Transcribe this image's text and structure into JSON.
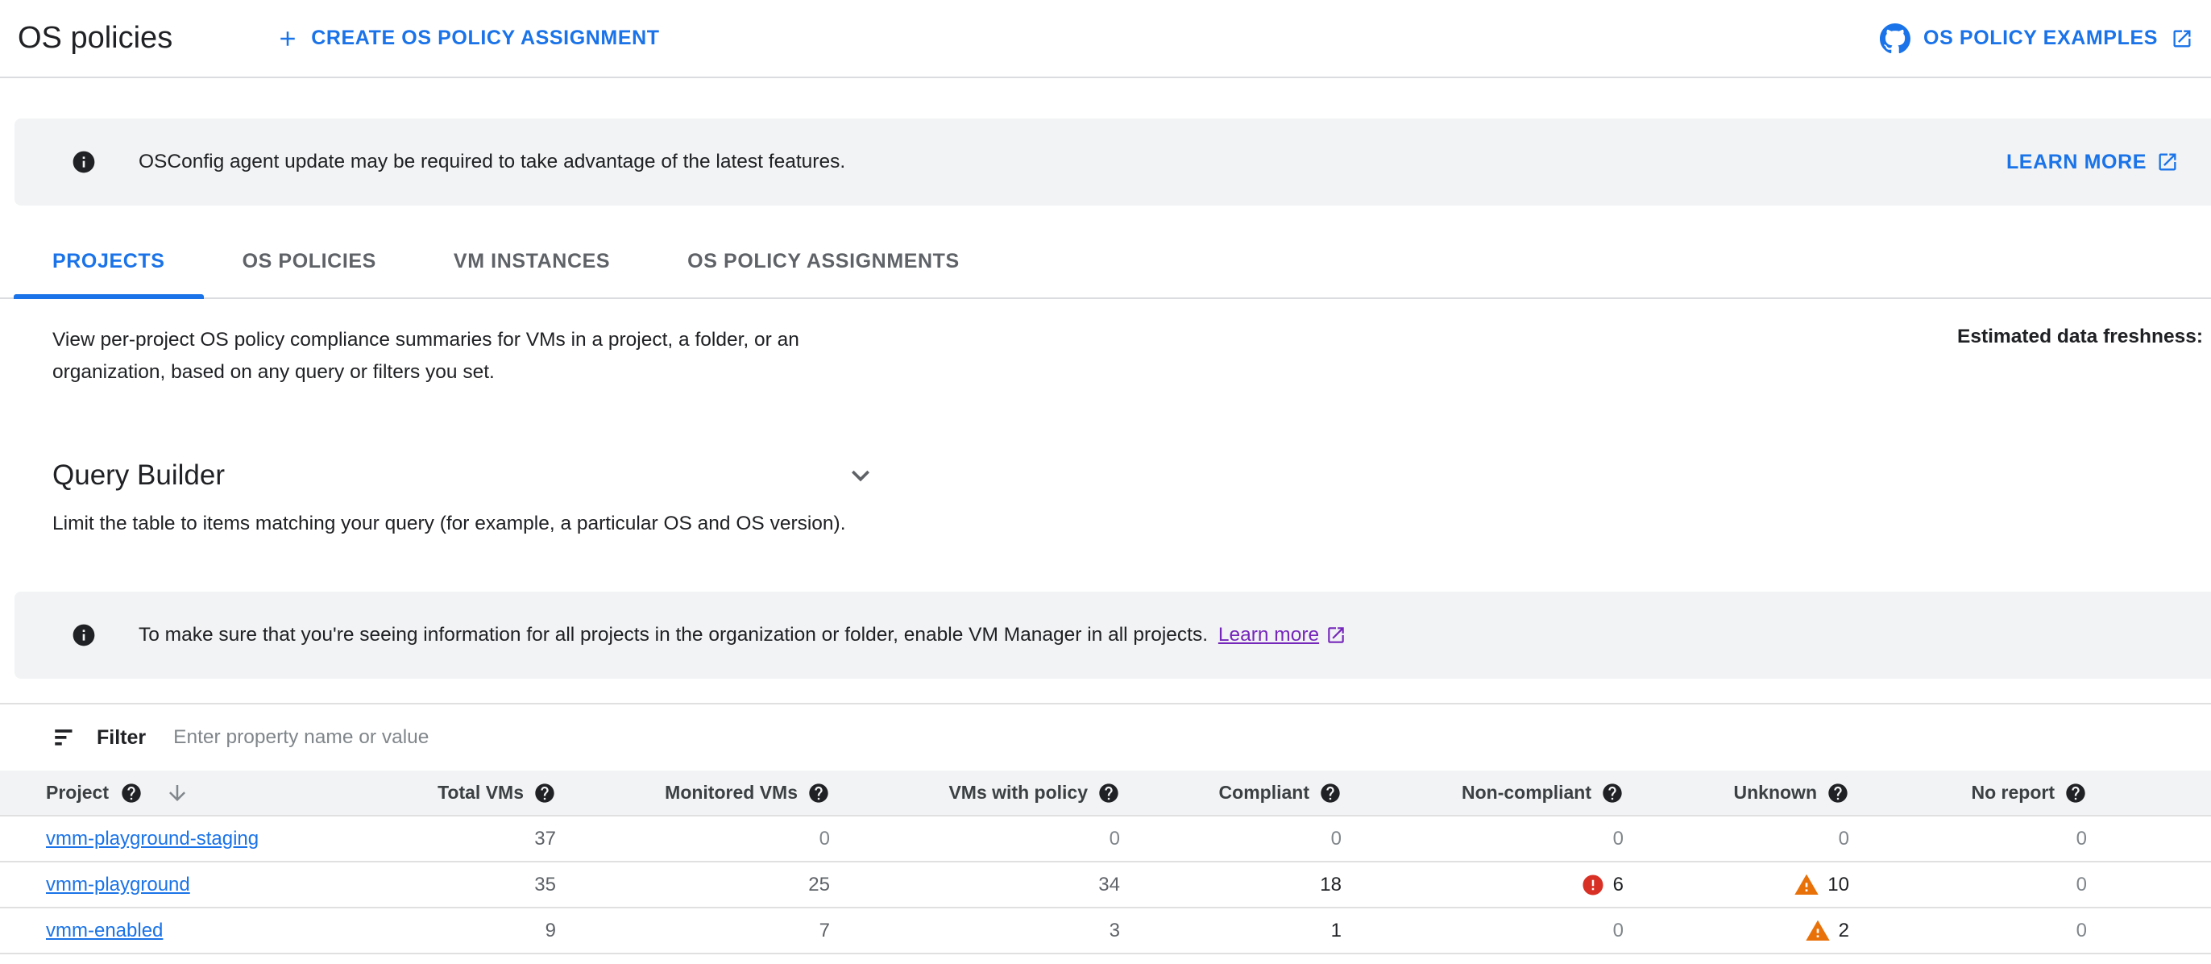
{
  "header": {
    "title": "OS policies",
    "create_button": "CREATE OS POLICY ASSIGNMENT",
    "examples_link": "OS POLICY EXAMPLES"
  },
  "update_banner": {
    "message": "OSConfig agent update may be required to take advantage of the latest features.",
    "learn_more": "LEARN MORE"
  },
  "tabs": [
    {
      "label": "PROJECTS",
      "active": true
    },
    {
      "label": "OS POLICIES",
      "active": false
    },
    {
      "label": "VM INSTANCES",
      "active": false
    },
    {
      "label": "OS POLICY ASSIGNMENTS",
      "active": false
    }
  ],
  "overview": {
    "description": "View per-project OS policy compliance summaries for VMs in a project, a folder, or an organization, based on any query or filters you set.",
    "freshness_label": "Estimated data freshness:"
  },
  "query_builder": {
    "title": "Query Builder",
    "hint": "Limit the table to items matching your query (for example, a particular OS and OS version)."
  },
  "vm_manager_banner": {
    "message": "To make sure that you're seeing information for all projects in the organization or folder, enable VM Manager in all projects.",
    "learn_more": "Learn more"
  },
  "filter_bar": {
    "label": "Filter",
    "placeholder": "Enter property name or value"
  },
  "table": {
    "columns": [
      {
        "label": "Project"
      },
      {
        "label": "Total VMs"
      },
      {
        "label": "Monitored VMs"
      },
      {
        "label": "VMs with policy"
      },
      {
        "label": "Compliant"
      },
      {
        "label": "Non-compliant"
      },
      {
        "label": "Unknown"
      },
      {
        "label": "No report"
      }
    ],
    "rows": [
      {
        "project": "vmm-playground-staging",
        "total_vms": "37",
        "monitored_vms": "0",
        "vms_with_policy": "0",
        "compliant": "0",
        "non_compliant": "0",
        "unknown": "0",
        "no_report": "0"
      },
      {
        "project": "vmm-playground",
        "total_vms": "35",
        "monitored_vms": "25",
        "vms_with_policy": "34",
        "compliant": "18",
        "non_compliant": "6",
        "unknown": "10",
        "no_report": "0"
      },
      {
        "project": "vmm-enabled",
        "total_vms": "9",
        "monitored_vms": "7",
        "vms_with_policy": "3",
        "compliant": "1",
        "non_compliant": "0",
        "unknown": "2",
        "no_report": "0"
      }
    ]
  },
  "colors": {
    "accent_blue": "#1a73e8",
    "link_purple": "#7627bb",
    "error_red": "#d93025",
    "warning_orange": "#e8710a",
    "banner_bg": "#f1f3f4"
  }
}
